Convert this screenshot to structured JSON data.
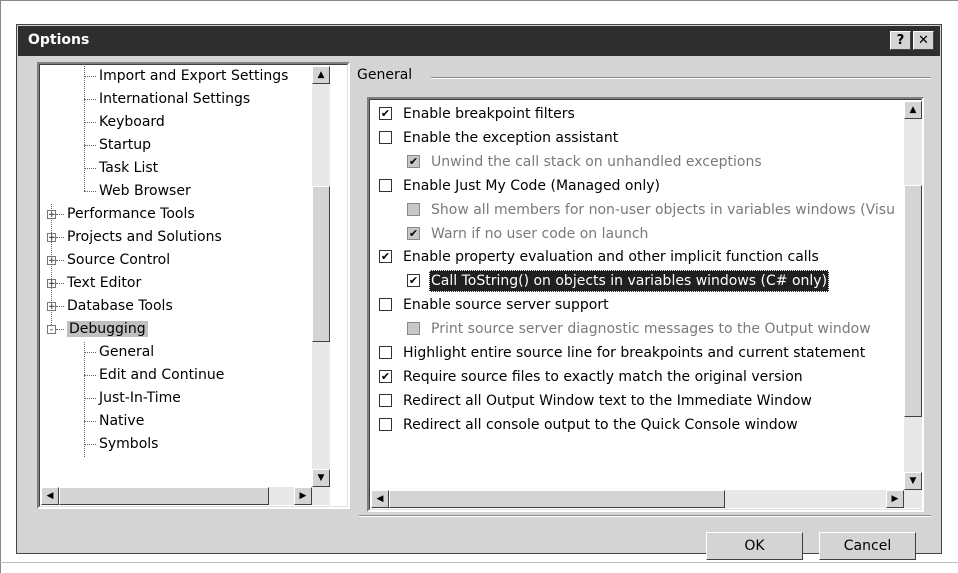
{
  "window": {
    "title": "Options",
    "help_glyph": "?",
    "close_glyph": "✕"
  },
  "tree": {
    "items": [
      {
        "label": "Import and Export Settings",
        "level": 1,
        "expander": ""
      },
      {
        "label": "International Settings",
        "level": 1,
        "expander": ""
      },
      {
        "label": "Keyboard",
        "level": 1,
        "expander": ""
      },
      {
        "label": "Startup",
        "level": 1,
        "expander": ""
      },
      {
        "label": "Task List",
        "level": 1,
        "expander": ""
      },
      {
        "label": "Web Browser",
        "level": 1,
        "expander": ""
      },
      {
        "label": "Performance Tools",
        "level": 0,
        "expander": "+"
      },
      {
        "label": "Projects and Solutions",
        "level": 0,
        "expander": "+"
      },
      {
        "label": "Source Control",
        "level": 0,
        "expander": "+"
      },
      {
        "label": "Text Editor",
        "level": 0,
        "expander": "+"
      },
      {
        "label": "Database Tools",
        "level": 0,
        "expander": "+"
      },
      {
        "label": "Debugging",
        "level": 0,
        "expander": "-",
        "selected": true
      },
      {
        "label": "General",
        "level": 1,
        "expander": ""
      },
      {
        "label": "Edit and Continue",
        "level": 1,
        "expander": ""
      },
      {
        "label": "Just-In-Time",
        "level": 1,
        "expander": ""
      },
      {
        "label": "Native",
        "level": 1,
        "expander": ""
      },
      {
        "label": "Symbols",
        "level": 1,
        "expander": ""
      }
    ]
  },
  "group": {
    "label": "General"
  },
  "options": [
    {
      "label": "Enable breakpoint filters",
      "checked": true,
      "indent": 0,
      "disabled": false
    },
    {
      "label": "Enable the exception assistant",
      "checked": false,
      "indent": 0,
      "disabled": false
    },
    {
      "label": "Unwind the call stack on unhandled exceptions",
      "checked": true,
      "indent": 1,
      "disabled": true
    },
    {
      "label": "Enable Just My Code (Managed only)",
      "checked": false,
      "indent": 0,
      "disabled": false
    },
    {
      "label": "Show all members for non-user objects in variables windows (Visu",
      "checked": false,
      "indent": 1,
      "disabled": true
    },
    {
      "label": "Warn if no user code on launch",
      "checked": true,
      "indent": 1,
      "disabled": true
    },
    {
      "label": "Enable property evaluation and other implicit function calls",
      "checked": true,
      "indent": 0,
      "disabled": false
    },
    {
      "label": "Call ToString() on objects in variables windows (C# only)",
      "checked": true,
      "indent": 1,
      "disabled": false,
      "highlighted": true
    },
    {
      "label": "Enable source server support",
      "checked": false,
      "indent": 0,
      "disabled": false
    },
    {
      "label": "Print source server diagnostic messages to the Output window",
      "checked": false,
      "indent": 1,
      "disabled": true
    },
    {
      "label": "Highlight entire source line for breakpoints and current statement",
      "checked": false,
      "indent": 0,
      "disabled": false
    },
    {
      "label": "Require source files to exactly match the original version",
      "checked": true,
      "indent": 0,
      "disabled": false
    },
    {
      "label": "Redirect all Output Window text to the Immediate Window",
      "checked": false,
      "indent": 0,
      "disabled": false
    },
    {
      "label": "Redirect all console output to the Quick Console window",
      "checked": false,
      "indent": 0,
      "disabled": false
    }
  ],
  "buttons": {
    "ok": "OK",
    "cancel": "Cancel"
  },
  "glyphs": {
    "up": "▲",
    "down": "▼",
    "left": "◀",
    "right": "▶",
    "check": "✔"
  }
}
